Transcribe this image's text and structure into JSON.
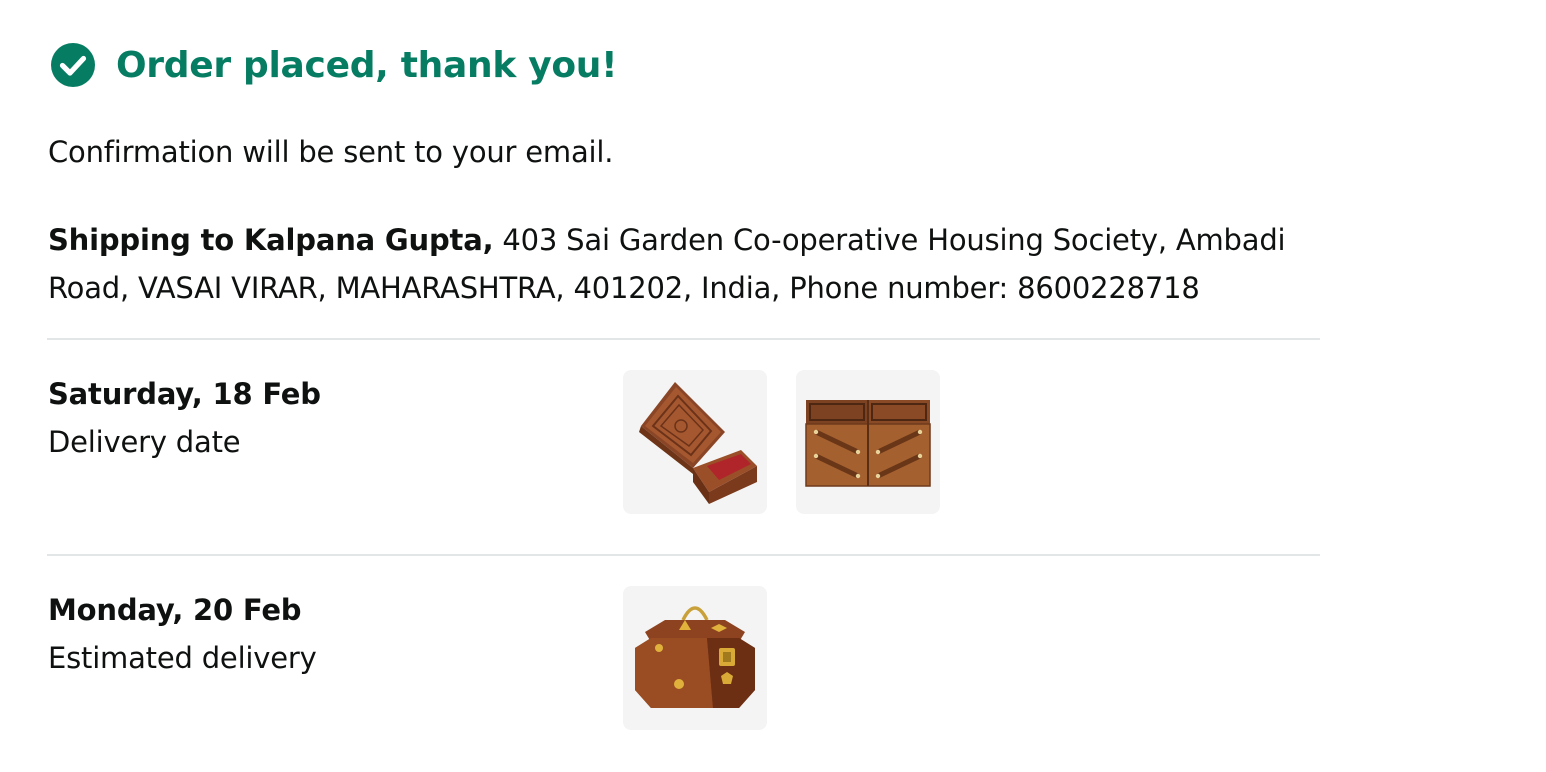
{
  "header": {
    "title": "Order placed, thank you!",
    "icon": "check-circle-icon",
    "accent_color": "#067d62"
  },
  "confirmation": {
    "text": "Confirmation will be sent to your email."
  },
  "shipping": {
    "name_label": "Shipping to Kalpana Gupta,",
    "address": " 403 Sai Garden Co-operative Housing Society, Ambadi Road, VASAI VIRAR, MAHARASHTRA, 401202, India, Phone number: 8600228718"
  },
  "deliveries": [
    {
      "date": "Saturday, 18 Feb",
      "label": "Delivery date",
      "items": [
        "carved-wooden-box-open-image",
        "wooden-cantilever-jewellery-box-image"
      ]
    },
    {
      "date": "Monday, 20 Feb",
      "label": "Estimated delivery",
      "items": [
        "octagonal-wooden-box-with-brass-handle-image"
      ]
    }
  ]
}
